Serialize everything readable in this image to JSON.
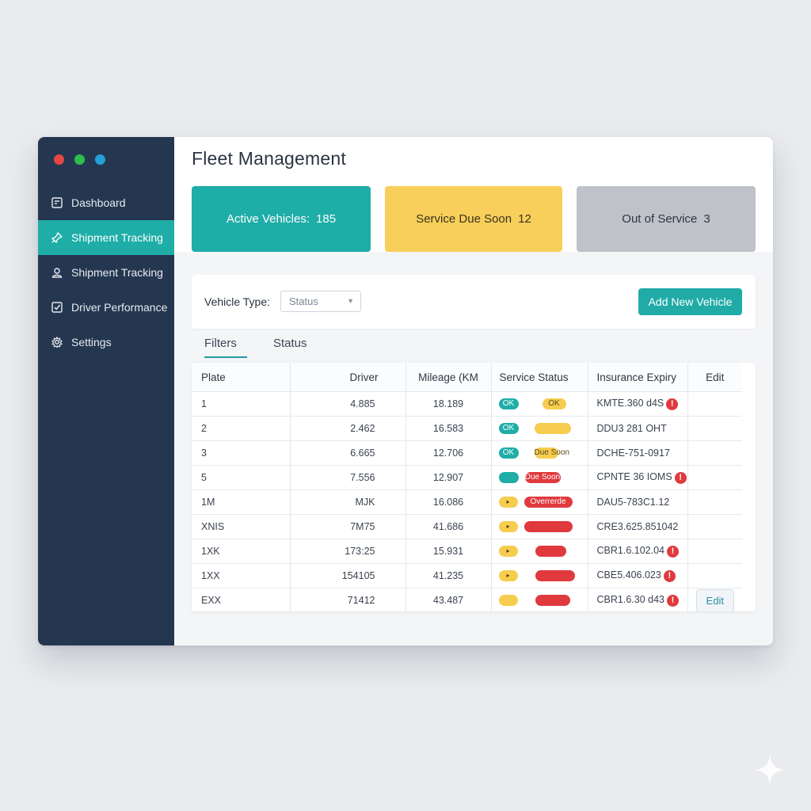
{
  "window": {
    "controls": [
      {
        "name": "close",
        "color": "#e64646"
      },
      {
        "name": "minimize",
        "color": "#2fbe4e"
      },
      {
        "name": "maximize",
        "color": "#23a2d6"
      }
    ]
  },
  "sidebar": {
    "items": [
      {
        "label": "Dashboard",
        "icon": "dashboard-icon",
        "active": false
      },
      {
        "label": "Shipment Tracking",
        "icon": "pin-icon",
        "active": true
      },
      {
        "label": "Shipment Tracking",
        "icon": "user-icon",
        "active": false
      },
      {
        "label": "Driver Performance",
        "icon": "checkbox-icon",
        "active": false
      },
      {
        "label": "Settings",
        "icon": "gear-icon",
        "active": false
      }
    ]
  },
  "header": {
    "title": "Fleet Management"
  },
  "stats": [
    {
      "label": "Active Vehicles:",
      "value": "185",
      "bg": "#1fada8",
      "fg": "#ffffff"
    },
    {
      "label": "Service Due Soon",
      "value": "12",
      "bg": "#f8cf5a",
      "fg": "#3a3320"
    },
    {
      "label": "Out of Service",
      "value": "3",
      "bg": "#bfc3c9",
      "fg": "#2e3641"
    }
  ],
  "toolbar": {
    "filter_label": "Vehicle Type:",
    "select_value": "Status",
    "add_label": "Add New Vehicle"
  },
  "tabs": [
    {
      "label": "Filters",
      "active": true
    },
    {
      "label": "Status",
      "active": false
    }
  ],
  "table": {
    "headers": {
      "plate": "Plate",
      "driver": "Driver",
      "mileage": "Mileage (KM",
      "service": "Service Status",
      "insurance": "Insurance Expiry",
      "edit": "Edit"
    },
    "rows": [
      {
        "plate": "1",
        "driver": "4.885",
        "mileage": "18.189",
        "service": [
          {
            "color": "teal",
            "text": "OK"
          },
          {
            "color": "yellow",
            "text": "OK"
          }
        ],
        "insurance": "KMTE.360 d4S",
        "warn": true,
        "edit": ""
      },
      {
        "plate": "2",
        "driver": "2.462",
        "mileage": "16.583",
        "service": [
          {
            "color": "teal",
            "text": "OK"
          },
          {
            "color": "yellow",
            "text": ""
          }
        ],
        "insurance": "DDU3 281 OHT",
        "warn": false,
        "edit": ""
      },
      {
        "plate": "3",
        "driver": "6.665",
        "mileage": "12.706",
        "service": [
          {
            "color": "teal",
            "text": "OK"
          },
          {
            "color": "yellow",
            "text": "Due Soon"
          }
        ],
        "insurance": "DCHE-751-0917",
        "warn": false,
        "edit": ""
      },
      {
        "plate": "5",
        "driver": "7.556",
        "mileage": "12.907",
        "service": [
          {
            "color": "teal",
            "text": ""
          },
          {
            "color": "red",
            "text": "Due Soon"
          }
        ],
        "insurance": "CPNTE 36 IOMS",
        "warn": true,
        "edit": ""
      },
      {
        "plate": "1M",
        "driver": "MJK",
        "mileage": "16.086",
        "service": [
          {
            "color": "yellow",
            "text": "▸"
          },
          {
            "color": "red",
            "text": "Overrerde"
          }
        ],
        "insurance": "DAU5-783C1.12",
        "warn": false,
        "edit": ""
      },
      {
        "plate": "XNIS",
        "driver": "7M75",
        "mileage": "41.686",
        "service": [
          {
            "color": "yellow",
            "text": "▸"
          },
          {
            "color": "red",
            "text": ""
          }
        ],
        "insurance": "CRE3.625.851042",
        "warn": false,
        "edit": ""
      },
      {
        "plate": "1XK",
        "driver": "173:25",
        "mileage": "15.931",
        "service": [
          {
            "color": "yellow",
            "text": "▸"
          },
          {
            "color": "red",
            "text": ""
          }
        ],
        "insurance": "CBR1.6.102.04",
        "warn": true,
        "edit": ""
      },
      {
        "plate": "1XX",
        "driver": "154105",
        "mileage": "41.235",
        "service": [
          {
            "color": "yellow",
            "text": "▸"
          },
          {
            "color": "red",
            "text": ""
          }
        ],
        "insurance": "CBE5.406.023",
        "warn": true,
        "edit": ""
      },
      {
        "plate": "EXX",
        "driver": "71412",
        "mileage": "43.487",
        "service": [
          {
            "color": "yellow",
            "text": ""
          },
          {
            "color": "red",
            "text": ""
          }
        ],
        "insurance": "CBR1.6.30 d43",
        "warn": true,
        "edit": "Edit"
      }
    ]
  },
  "colors": {
    "sidebar": "#253750",
    "accent": "#1fada8",
    "warning": "#f6cd4f",
    "danger": "#e0393e"
  }
}
